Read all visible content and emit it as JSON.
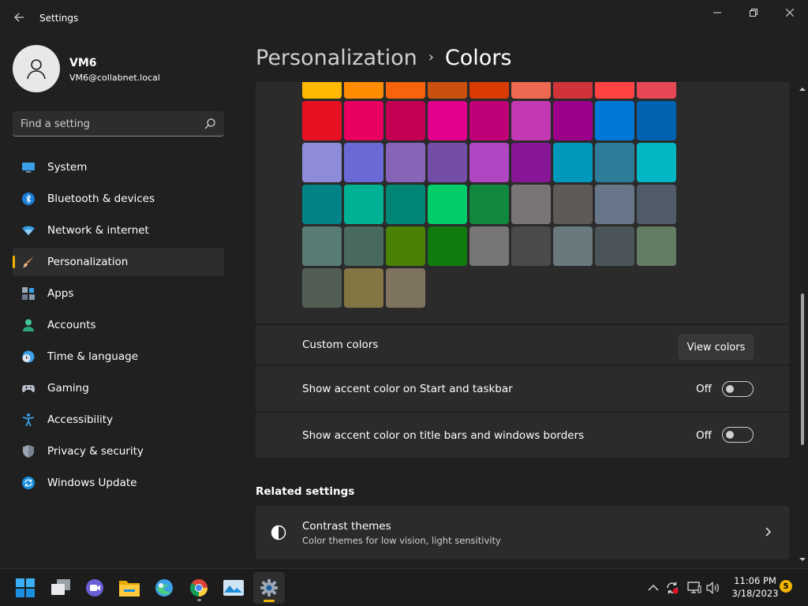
{
  "window": {
    "title": "Settings"
  },
  "profile": {
    "name": "VM6",
    "email": "VM6@collabnet.local"
  },
  "search": {
    "placeholder": "Find a setting"
  },
  "nav": {
    "items": [
      {
        "label": "System",
        "icon": "monitor-icon"
      },
      {
        "label": "Bluetooth & devices",
        "icon": "bluetooth-icon"
      },
      {
        "label": "Network & internet",
        "icon": "wifi-icon"
      },
      {
        "label": "Personalization",
        "icon": "brush-icon",
        "active": true
      },
      {
        "label": "Apps",
        "icon": "apps-icon"
      },
      {
        "label": "Accounts",
        "icon": "person-icon"
      },
      {
        "label": "Time & language",
        "icon": "clock-globe-icon"
      },
      {
        "label": "Gaming",
        "icon": "gamepad-icon"
      },
      {
        "label": "Accessibility",
        "icon": "accessibility-icon"
      },
      {
        "label": "Privacy & security",
        "icon": "shield-icon"
      },
      {
        "label": "Windows Update",
        "icon": "update-icon"
      }
    ]
  },
  "header": {
    "parent": "Personalization",
    "separator": "›",
    "current": "Colors"
  },
  "accent_swatches": [
    [
      "#FFB900",
      "#FF8C00",
      "#F7630C",
      "#CA5010",
      "#DA3B01",
      "#EF6950",
      "#D13438",
      "#FF4343",
      "#E74856"
    ],
    [
      "#E81123",
      "#EA005E",
      "#C30052",
      "#E3008C",
      "#BF0077",
      "#C239B3",
      "#9A0089",
      "#0078D7",
      "#0063B1"
    ],
    [
      "#8E8CD8",
      "#6B69D6",
      "#8764B8",
      "#744DA9",
      "#B146C2",
      "#881798",
      "#0099BC",
      "#2D7D9A",
      "#00B7C3"
    ],
    [
      "#038387",
      "#00B294",
      "#018574",
      "#00CC6A",
      "#10893E",
      "#7A7574",
      "#5D5A58",
      "#68768A",
      "#515C6B"
    ],
    [
      "#567C73",
      "#486860",
      "#498205",
      "#107C10",
      "#767676",
      "#4C4A48",
      "#69797E",
      "#4A5459",
      "#647C64"
    ],
    [
      "#525E54",
      "#847545",
      "#7E735F"
    ]
  ],
  "custom_colors": {
    "label": "Custom colors",
    "button": "View colors"
  },
  "toggles": [
    {
      "label": "Show accent color on Start and taskbar",
      "state": "Off"
    },
    {
      "label": "Show accent color on title bars and windows borders",
      "state": "Off"
    }
  ],
  "related": {
    "title": "Related settings",
    "contrast": {
      "title": "Contrast themes",
      "subtitle": "Color themes for low vision, light sensitivity"
    }
  },
  "taskbar": {
    "apps": [
      "start-icon",
      "task-view-icon",
      "chat-icon",
      "file-explorer-icon",
      "edge-icon",
      "chrome-icon",
      "photos-icon",
      "settings-icon"
    ],
    "clock": {
      "time": "11:06 PM",
      "date": "3/18/2023"
    },
    "notifications": "5"
  },
  "colors": {
    "accent": "#F2B600",
    "background": "#202020",
    "card": "#2B2B2B"
  }
}
